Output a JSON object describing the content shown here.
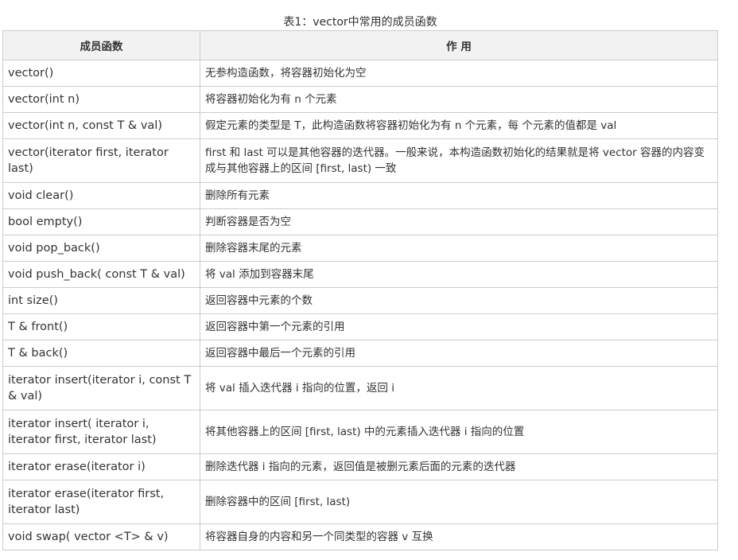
{
  "caption": "表1：vector中常用的成员函数",
  "table": {
    "headers": [
      "成员函数",
      "作 用"
    ],
    "rows": [
      {
        "func": "vector()",
        "desc": "无参构造函数，将容器初始化为空"
      },
      {
        "func": "vector(int n)",
        "desc": "将容器初始化为有 n 个元素"
      },
      {
        "func": "vector(int n, const T & val)",
        "desc": "假定元素的类型是 T，此构造函数将容器初始化为有 n 个元素，每 个元素的值都是 val"
      },
      {
        "func": "vector(iterator first, iterator last)",
        "desc": "first 和 last 可以是其他容器的迭代器。一般来说，本构造函数初始化的结果就是将 vector 容器的内容变成与其他容器上的区间 [first, last) 一致"
      },
      {
        "func": "void clear()",
        "desc": "删除所有元素"
      },
      {
        "func": "bool empty()",
        "desc": "判断容器是否为空"
      },
      {
        "func": "void pop_back()",
        "desc": "删除容器末尾的元素"
      },
      {
        "func": "void push_back( const T & val)",
        "desc": "将 val 添加到容器末尾"
      },
      {
        "func": "int size()",
        "desc": "返回容器中元素的个数"
      },
      {
        "func": "T & front()",
        "desc": "返回容器中第一个元素的引用"
      },
      {
        "func": "T & back()",
        "desc": "返回容器中最后一个元素的引用"
      },
      {
        "func": "iterator insert(iterator i, const T & val)",
        "desc": "将 val 插入迭代器 i 指向的位置，返回 i"
      },
      {
        "func": "iterator insert( iterator i, iterator first, iterator last)",
        "desc": "将其他容器上的区间 [first, last) 中的元素插入迭代器 i 指向的位置"
      },
      {
        "func": "iterator erase(iterator i)",
        "desc": "删除迭代器 i 指向的元素，返回值是被删元素后面的元素的迭代器"
      },
      {
        "func": "iterator erase(iterator first, iterator last)",
        "desc": "删除容器中的区间 [first, last)"
      },
      {
        "func": "void swap( vector <T> & v)",
        "desc": "将容器自身的内容和另一个同类型的容器 v 互换"
      }
    ]
  }
}
